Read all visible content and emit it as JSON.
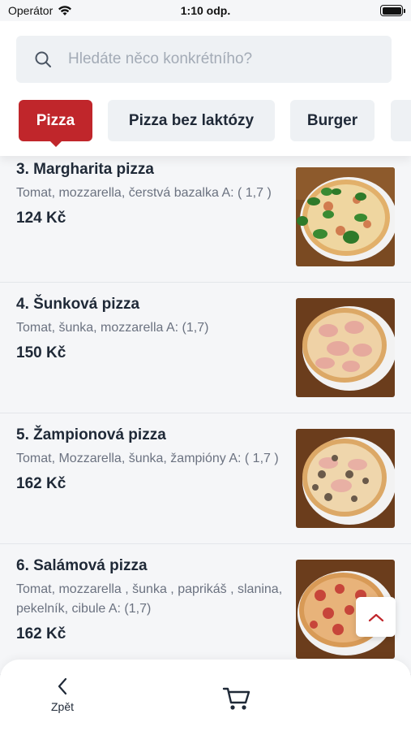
{
  "status_bar": {
    "carrier": "Operátor",
    "time": "1:10 odp."
  },
  "search": {
    "placeholder": "Hledáte něco konkrétního?",
    "icon": "search-icon"
  },
  "categories": [
    {
      "label": "Pizza",
      "active": true
    },
    {
      "label": "Pizza bez laktózy",
      "active": false
    },
    {
      "label": "Burger",
      "active": false
    }
  ],
  "items": [
    {
      "name": "3. Margharita pizza",
      "description": "Tomat, mozzarella, čerstvá bazalka A: ( 1,7 )",
      "price": "124 Kč"
    },
    {
      "name": "4. Šunková pizza",
      "description": "Tomat, šunka, mozzarella A: (1,7)",
      "price": "150 Kč"
    },
    {
      "name": "5. Žampionová pizza",
      "description": "Tomat, Mozzarella, šunka, žampióny A: ( 1,7 )",
      "price": "162 Kč"
    },
    {
      "name": "6. Salámová pizza",
      "description": "Tomat, mozzarella , šunka , paprikáš , slanina, pekelník, cibule A: (1,7)",
      "price": "162 Kč"
    }
  ],
  "bottom_bar": {
    "back_label": "Zpět",
    "cart_icon": "cart-icon"
  },
  "colors": {
    "accent": "#c0262b",
    "background": "#f5f6f8"
  }
}
